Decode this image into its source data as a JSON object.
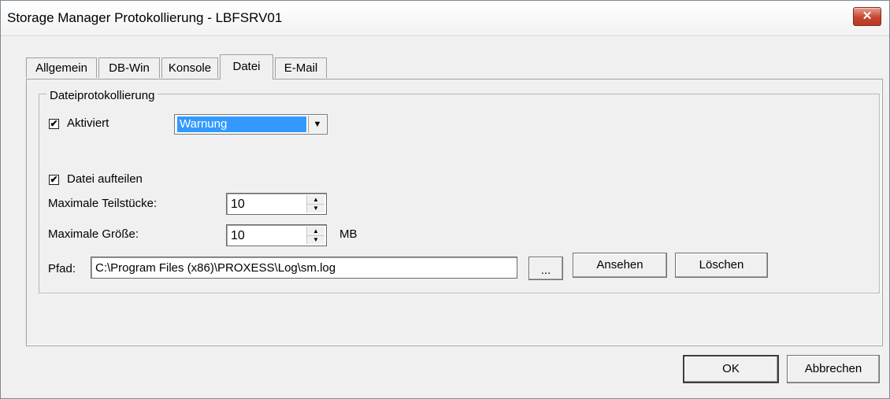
{
  "window": {
    "title": "Storage Manager Protokollierung - LBFSRV01",
    "close_label": "✕"
  },
  "tabs": [
    {
      "label": "Allgemein",
      "active": false
    },
    {
      "label": "DB-Win",
      "active": false
    },
    {
      "label": "Konsole",
      "active": false
    },
    {
      "label": "Datei",
      "active": true
    },
    {
      "label": "E-Mail",
      "active": false
    }
  ],
  "file_logging": {
    "group_title": "Dateiprotokollierung",
    "enabled_label": "Aktiviert",
    "enabled_checked": true,
    "level_value": "Warnung",
    "split_label": "Datei aufteilen",
    "split_checked": true,
    "max_parts_label": "Maximale Teilstücke:",
    "max_parts_value": "10",
    "max_size_label": "Maximale Größe:",
    "max_size_value": "10",
    "max_size_unit": "MB",
    "path_label": "Pfad:",
    "path_value": "C:\\Program Files (x86)\\PROXESS\\Log\\sm.log",
    "browse_label": "...",
    "view_label": "Ansehen",
    "delete_label": "Löschen"
  },
  "footer": {
    "ok_label": "OK",
    "cancel_label": "Abbrechen"
  },
  "icons": {
    "check": "✔",
    "dropdown": "▼",
    "spin_up": "▲",
    "spin_down": "▼"
  }
}
